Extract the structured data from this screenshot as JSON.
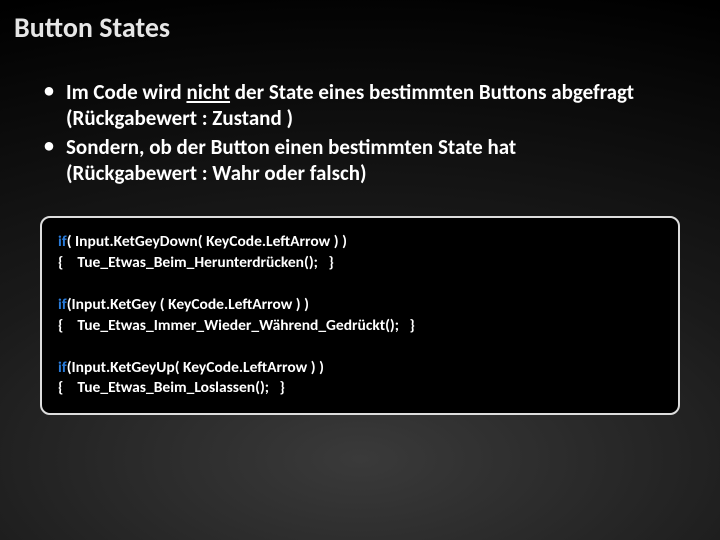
{
  "title": "Button States",
  "bullets": [
    {
      "line1_pre": "Im Code wird ",
      "line1_underlined": "nicht",
      "line1_post": " der State eines bestimmten Buttons abgefragt",
      "line2": "(Rückgabewert :  Zustand )"
    },
    {
      "line1": "Sondern, ob der Button einen bestimmten State hat",
      "line2": "(Rückgabewert :  Wahr oder falsch)"
    }
  ],
  "code": {
    "kw": "if",
    "b1l1_rest": "( Input.KetGeyDown( KeyCode.LeftArrow ) )",
    "b1l2": "{    Tue_Etwas_Beim_Herunterdrücken();   }",
    "b2l1_rest": "(Input.KetGey ( KeyCode.LeftArrow ) )",
    "b2l2": "{    Tue_Etwas_Immer_Wieder_Während_Gedrückt();   }",
    "b3l1_rest": "(Input.KetGeyUp( KeyCode.LeftArrow ) )",
    "b3l2": "{    Tue_Etwas_Beim_Loslassen();   }"
  }
}
